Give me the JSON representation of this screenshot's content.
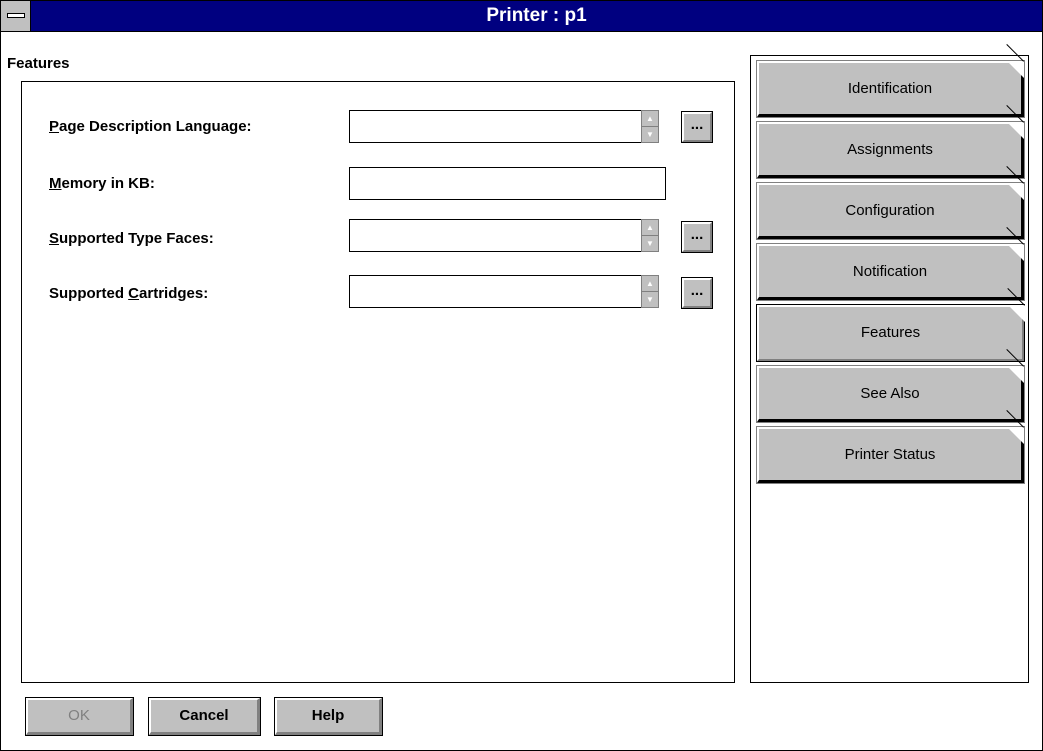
{
  "window": {
    "title": "Printer : p1"
  },
  "section": {
    "label": "Features"
  },
  "fields": [
    {
      "label_pre": "",
      "label_key": "P",
      "label_post": "age Description Language:",
      "value": "",
      "has_spinner": true,
      "has_browse": true
    },
    {
      "label_pre": "",
      "label_key": "M",
      "label_post": "emory in KB:",
      "value": "",
      "has_spinner": false,
      "has_browse": false
    },
    {
      "label_pre": "",
      "label_key": "S",
      "label_post": "upported Type Faces:",
      "value": "",
      "has_spinner": true,
      "has_browse": true
    },
    {
      "label_pre": "Supported ",
      "label_key": "C",
      "label_post": "artridges:",
      "value": "",
      "has_spinner": true,
      "has_browse": true
    }
  ],
  "browse_label": "...",
  "tabs": [
    {
      "label": "Identification",
      "active": false
    },
    {
      "label": "Assignments",
      "active": false
    },
    {
      "label": "Configuration",
      "active": false
    },
    {
      "label": "Notification",
      "active": false
    },
    {
      "label": "Features",
      "active": true
    },
    {
      "label": "See Also",
      "active": false
    },
    {
      "label": "Printer Status",
      "active": false
    }
  ],
  "buttons": {
    "ok": "OK",
    "cancel": "Cancel",
    "help": "Help"
  },
  "colors": {
    "titlebar": "#000080",
    "face": "#c0c0c0"
  }
}
